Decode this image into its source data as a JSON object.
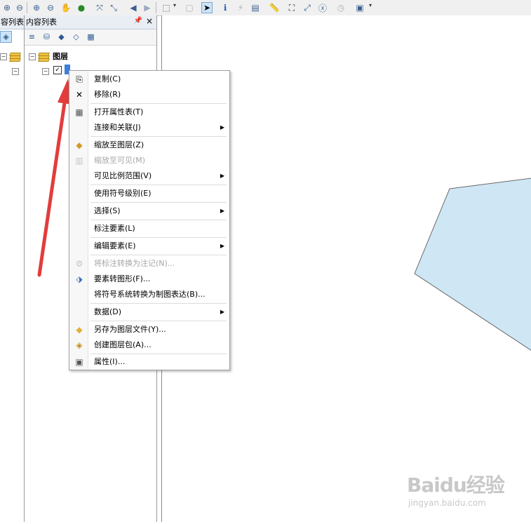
{
  "toc": {
    "left_strip_title": "内容列表",
    "title": "内容列表",
    "pin": "ᵖ",
    "close": "×",
    "root_label": "图层"
  },
  "context_menu": {
    "items": [
      {
        "label": "复制(C)",
        "icon": "copy-icon",
        "disabled": false,
        "submenu": false
      },
      {
        "label": "移除(R)",
        "icon": "remove-icon",
        "disabled": false,
        "submenu": false
      },
      {
        "label": "打开属性表(T)",
        "icon": "table-icon",
        "disabled": false,
        "submenu": false
      },
      {
        "label": "连接和关联(J)",
        "icon": "",
        "disabled": false,
        "submenu": true
      },
      {
        "label": "缩放至图层(Z)",
        "icon": "zoom-to-layer-icon",
        "disabled": false,
        "submenu": false
      },
      {
        "label": "缩放至可见(M)",
        "icon": "zoom-to-visible-icon",
        "disabled": true,
        "submenu": false
      },
      {
        "label": "可见比例范围(V)",
        "icon": "",
        "disabled": false,
        "submenu": true
      },
      {
        "label": "使用符号级别(E)",
        "icon": "",
        "disabled": false,
        "submenu": false
      },
      {
        "label": "选择(S)",
        "icon": "",
        "disabled": false,
        "submenu": true
      },
      {
        "label": "标注要素(L)",
        "icon": "",
        "disabled": false,
        "submenu": false
      },
      {
        "label": "编辑要素(E)",
        "icon": "",
        "disabled": false,
        "submenu": true
      },
      {
        "label": "将标注转换为注记(N)...",
        "icon": "convert-labels-icon",
        "disabled": true,
        "submenu": false
      },
      {
        "label": "要素转图形(F)...",
        "icon": "features-to-graphics-icon",
        "disabled": false,
        "submenu": false
      },
      {
        "label": "将符号系统转换为制图表达(B)...",
        "icon": "",
        "disabled": false,
        "submenu": false
      },
      {
        "label": "数据(D)",
        "icon": "",
        "disabled": false,
        "submenu": true
      },
      {
        "label": "另存为图层文件(Y)...",
        "icon": "save-layer-icon",
        "disabled": false,
        "submenu": false
      },
      {
        "label": "创建图层包(A)...",
        "icon": "layer-package-icon",
        "disabled": false,
        "submenu": false
      },
      {
        "label": "属性(I)...",
        "icon": "properties-icon",
        "disabled": false,
        "submenu": false
      }
    ]
  },
  "watermark": {
    "brand": "Baidu经验",
    "url": "jingyan.baidu.com"
  },
  "colors": {
    "polygon_fill": "#cfe6f5",
    "polygon_stroke": "#6b6b6b",
    "arrow": "#e23c3c",
    "toc_header": "#e9eef5"
  }
}
